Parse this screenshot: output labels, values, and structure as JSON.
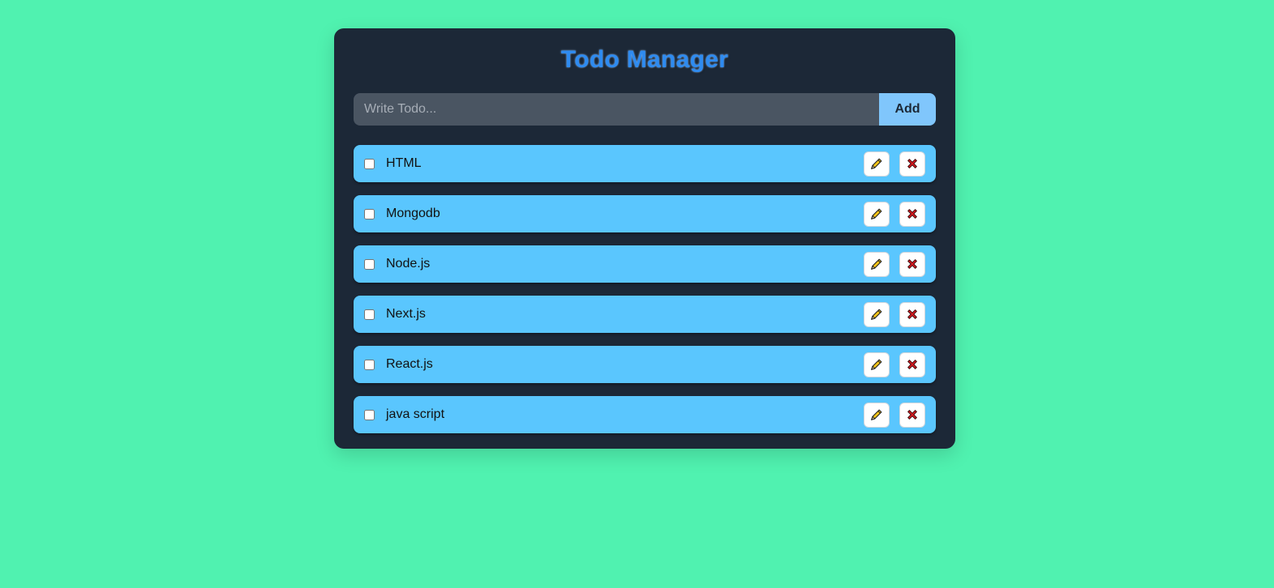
{
  "app": {
    "title": "Todo Manager"
  },
  "input": {
    "placeholder": "Write Todo...",
    "value": ""
  },
  "add_button": {
    "label": "Add"
  },
  "todos": [
    {
      "text": "HTML",
      "checked": false,
      "edit_icon": "pencil-icon",
      "delete_icon": "cross-icon"
    },
    {
      "text": "Mongodb",
      "checked": false,
      "edit_icon": "pencil-icon",
      "delete_icon": "cross-icon"
    },
    {
      "text": "Node.js",
      "checked": false,
      "edit_icon": "pencil-icon",
      "delete_icon": "cross-icon"
    },
    {
      "text": "Next.js",
      "checked": false,
      "edit_icon": "pencil-icon",
      "delete_icon": "cross-icon"
    },
    {
      "text": "React.js",
      "checked": false,
      "edit_icon": "pencil-icon",
      "delete_icon": "cross-icon"
    },
    {
      "text": "java script",
      "checked": false,
      "edit_icon": "pencil-icon",
      "delete_icon": "cross-icon"
    }
  ],
  "colors": {
    "page_background": "#50f2b0",
    "card_background": "#1c2837",
    "title": "#2e8bf0",
    "input_background": "#4a5562",
    "add_button": "#80c6fc",
    "item_background": "#5ac6fe",
    "pencil": "#f7c518",
    "cross": "#d71920"
  }
}
